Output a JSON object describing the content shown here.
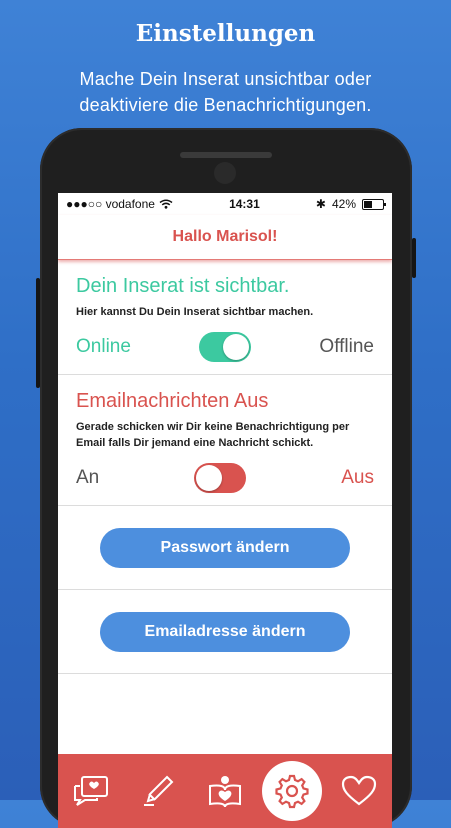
{
  "promo": {
    "title": "Einstellungen",
    "subtitle_line1": "Mache Dein Inserat unsichtbar oder",
    "subtitle_line2": "deaktiviere die Benachrichtigungen."
  },
  "status_bar": {
    "carrier": "●●●○○ vodafone",
    "time": "14:31",
    "battery": "42%"
  },
  "header": {
    "title": "Hallo Marisol!"
  },
  "visibility": {
    "title": "Dein Inserat ist sichtbar.",
    "description": "Hier kannst Du Dein Inserat sichtbar machen.",
    "left_label": "Online",
    "right_label": "Offline",
    "toggle_on": true
  },
  "email_notifications": {
    "title": "Emailnachrichten Aus",
    "description": "Gerade schicken wir Dir keine Benachrichtigung per Email falls Dir jemand eine Nachricht schickt.",
    "left_label": "An",
    "right_label": "Aus",
    "toggle_on": false
  },
  "buttons": {
    "change_password": "Passwort ändern",
    "change_email": "Emailadresse ändern"
  },
  "tabbar": {
    "items": [
      "chat-heart-icon",
      "pen-icon",
      "reader-heart-icon",
      "gear-icon",
      "heart-icon"
    ],
    "active": "gear-icon"
  },
  "colors": {
    "green": "#3cc9a0",
    "red": "#d9534f",
    "blue": "#4d8fde"
  }
}
